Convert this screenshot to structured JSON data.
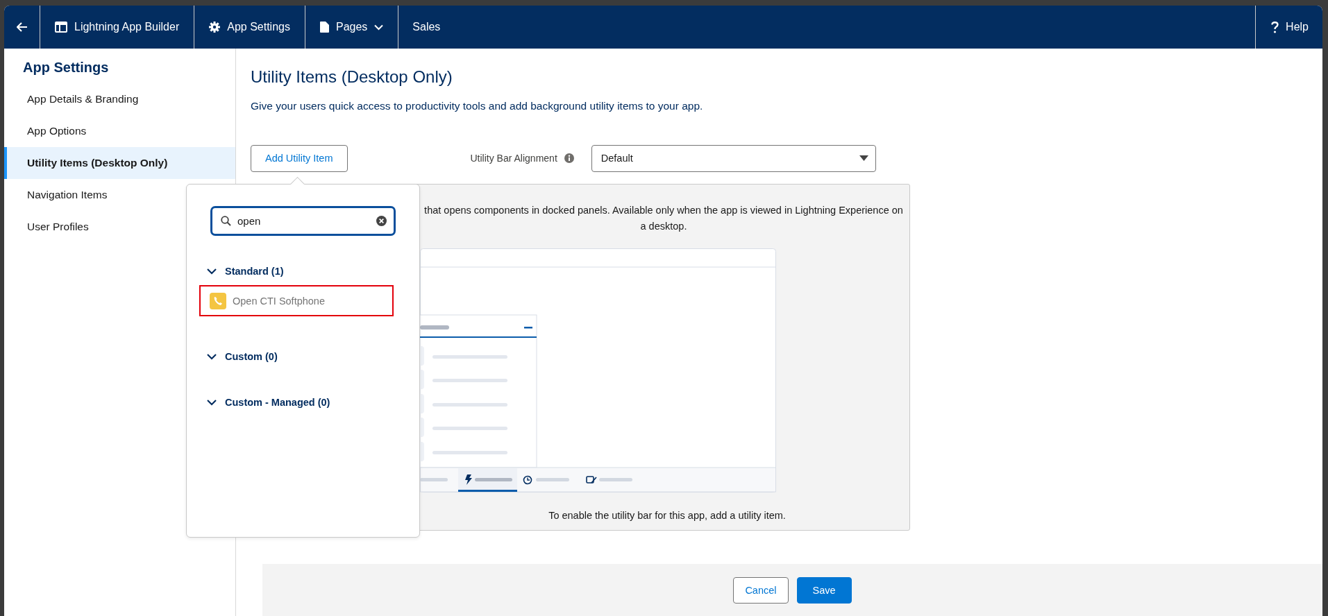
{
  "header": {
    "items": [
      {
        "kind": "builder",
        "label": "Lightning App Builder"
      },
      {
        "kind": "settings",
        "label": "App Settings"
      },
      {
        "kind": "pages",
        "label": "Pages"
      },
      {
        "kind": "plain",
        "label": "Sales"
      }
    ],
    "help": {
      "label": "Help"
    }
  },
  "sidebar": {
    "title": "App Settings",
    "items": [
      {
        "label": "App Details & Branding",
        "selected": false
      },
      {
        "label": "App Options",
        "selected": false
      },
      {
        "label": "Utility Items (Desktop Only)",
        "selected": true
      },
      {
        "label": "Navigation Items",
        "selected": false
      },
      {
        "label": "User Profiles",
        "selected": false
      }
    ]
  },
  "main": {
    "title": "Utility Items (Desktop Only)",
    "subtitle": "Give your users quick access to productivity tools and add background utility items to your app.",
    "add_button": "Add Utility Item",
    "alignment": {
      "label": "Utility Bar Alignment",
      "value": "Default"
    },
    "panel": {
      "description": "that opens components in docked panels. Available only when the app is viewed in Lightning Experience on a desktop.",
      "hint": "To enable the utility bar for this app, add a utility item."
    },
    "popover": {
      "search": {
        "value": "open"
      },
      "sections": [
        {
          "label": "Standard (1)",
          "expanded": true,
          "items": [
            {
              "label": "Open CTI Softphone",
              "highlighted": true
            }
          ]
        },
        {
          "label": "Custom (0)",
          "expanded": true
        },
        {
          "label": "Custom - Managed (0)",
          "expanded": true
        }
      ]
    }
  },
  "footer": {
    "buttons": [
      {
        "kind": "neutral",
        "label": "Cancel"
      },
      {
        "kind": "brand",
        "label": "Save"
      }
    ]
  }
}
